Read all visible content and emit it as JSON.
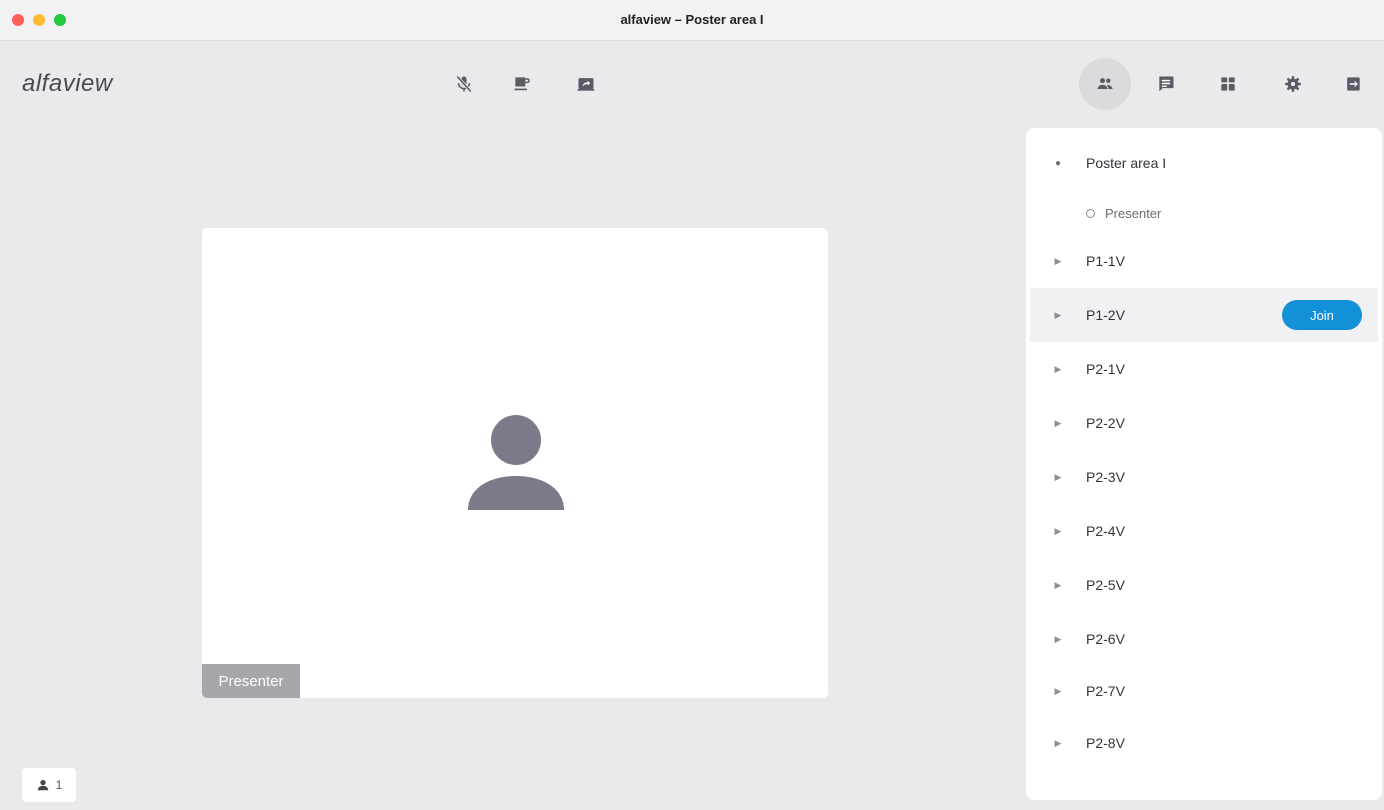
{
  "window": {
    "title": "alfaview – Poster area I"
  },
  "app": {
    "logo": "alfaview"
  },
  "toolbar_center": [
    {
      "name": "mic-muted-icon"
    },
    {
      "name": "coffee-icon"
    },
    {
      "name": "screen-share-icon"
    }
  ],
  "toolbar_right": [
    {
      "name": "participants-icon",
      "active": true
    },
    {
      "name": "chat-icon"
    },
    {
      "name": "rooms-grid-icon"
    },
    {
      "name": "settings-gear-icon"
    },
    {
      "name": "exit-icon"
    }
  ],
  "tile": {
    "label": "Presenter"
  },
  "participants": {
    "count": "1"
  },
  "panel": {
    "current_room": "Poster area I",
    "member": "Presenter",
    "join_label": "Join",
    "rooms": [
      "P1-1V",
      "P1-2V",
      "P2-1V",
      "P2-2V",
      "P2-3V",
      "P2-4V",
      "P2-5V",
      "P2-6V",
      "P2-7V",
      "P2-8V"
    ],
    "hover_room_index": 1
  },
  "colors": {
    "background": "#ebe9eb",
    "accent": "#1391d8",
    "icon": "#5b5b66",
    "avatar": "#7a7a89"
  }
}
